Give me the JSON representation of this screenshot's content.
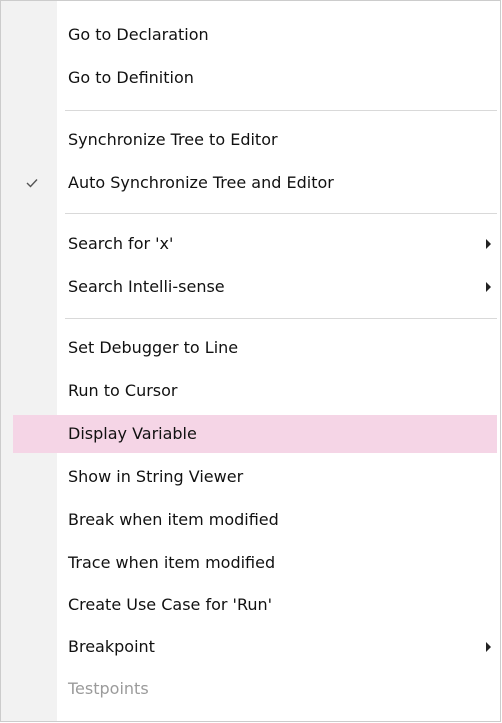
{
  "menu": {
    "items": [
      {
        "label": "Go to Declaration"
      },
      {
        "label": "Go to Definition"
      },
      {
        "label": "Synchronize Tree to Editor"
      },
      {
        "label": "Auto Synchronize Tree and Editor",
        "checked": true
      },
      {
        "label": "Search for 'x'",
        "submenu": true
      },
      {
        "label": "Search Intelli-sense",
        "submenu": true
      },
      {
        "label": "Set Debugger to Line"
      },
      {
        "label": "Run to Cursor"
      },
      {
        "label": "Display Variable",
        "highlighted": true
      },
      {
        "label": "Show in String Viewer"
      },
      {
        "label": "Break when item modified"
      },
      {
        "label": "Trace when item modified"
      },
      {
        "label": "Create Use Case for 'Run'"
      },
      {
        "label": "Breakpoint",
        "submenu": true
      },
      {
        "label": "Testpoints",
        "disabled": true
      }
    ]
  },
  "colors": {
    "highlight": "#f5d5e6",
    "gutter": "#f2f2f2",
    "disabled_text": "#9b9b9b"
  },
  "icons": {
    "check": "check-icon",
    "submenu": "chevron-right-icon"
  }
}
